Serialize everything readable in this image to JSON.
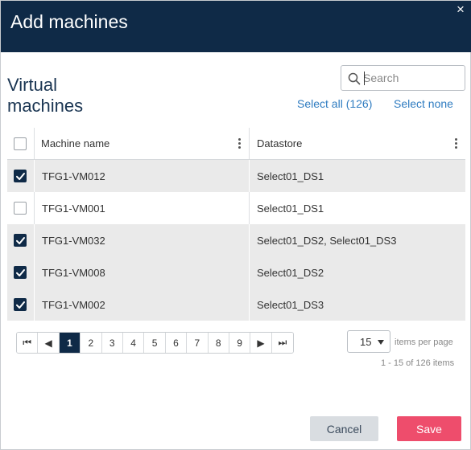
{
  "dialog": {
    "title": "Add machines",
    "close_glyph": "×"
  },
  "section": {
    "title": "Virtual machines"
  },
  "search": {
    "placeholder": "Search",
    "value": ""
  },
  "links": {
    "select_all": "Select all (126)",
    "select_none": "Select none"
  },
  "table": {
    "columns": [
      "Machine name",
      "Datastore"
    ],
    "header_checked": false,
    "rows": [
      {
        "name": "TFG1-VM012",
        "datastore": "Select01_DS1",
        "checked": true
      },
      {
        "name": "TFG1-VM001",
        "datastore": "Select01_DS1",
        "checked": false
      },
      {
        "name": "TFG1-VM032",
        "datastore": "Select01_DS2, Select01_DS3",
        "checked": true
      },
      {
        "name": "TFG1-VM008",
        "datastore": "Select01_DS2",
        "checked": true
      },
      {
        "name": "TFG1-VM002",
        "datastore": "Select01_DS3",
        "checked": true
      }
    ]
  },
  "pagination": {
    "first_glyph": "⏮",
    "prev_glyph": "◀",
    "next_glyph": "▶",
    "last_glyph": "⏭",
    "pages": [
      "1",
      "2",
      "3",
      "4",
      "5",
      "6",
      "7",
      "8",
      "9"
    ],
    "current_page": "1",
    "per_page_value": "15",
    "per_page_label": "items per page",
    "range_text": "1 - 15 of 126 items"
  },
  "buttons": {
    "cancel": "Cancel",
    "save": "Save"
  },
  "colors": {
    "header_bg": "#0f2a47",
    "accent_link": "#2f7cc1",
    "save_bg": "#ee4d6c",
    "cancel_bg": "#d9dde1",
    "row_shade": "#eaeaea"
  }
}
